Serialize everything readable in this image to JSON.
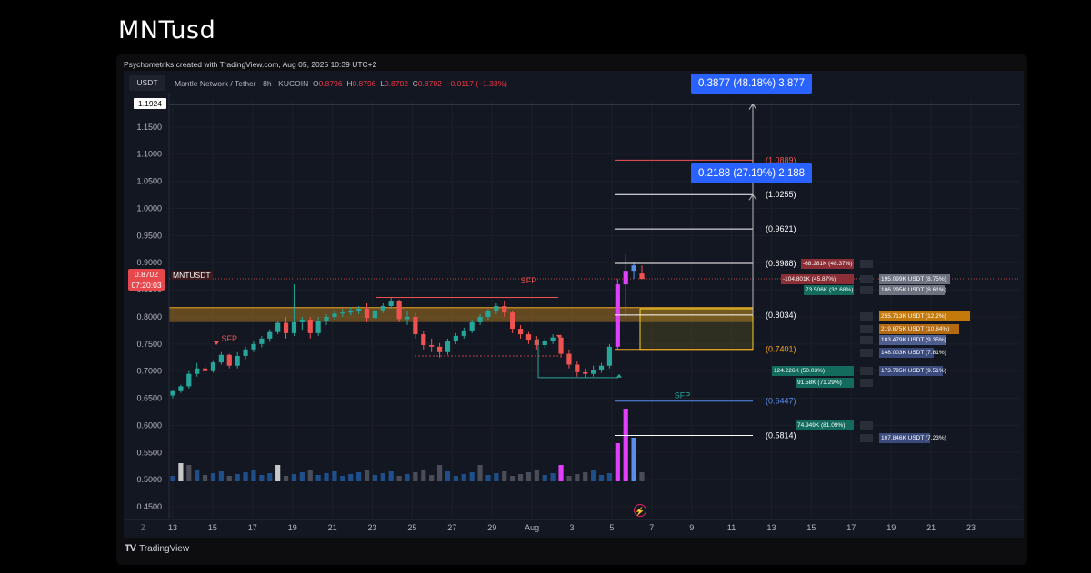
{
  "page": {
    "title": "MNTusd",
    "credit": "Psychometriks created with TradingView.com, Aug 05, 2025 10:39 UTC+2"
  },
  "header": {
    "currency": "USDT",
    "name": "Mantle Network / Tether · 8h · KUCOIN",
    "o_label": "O",
    "o": "0.8796",
    "h_label": "H",
    "h": "0.8796",
    "l_label": "L",
    "l": "0.8702",
    "c_label": "C",
    "c": "0.8702",
    "change": "−0.0117 (−1.33%)"
  },
  "price_tag": {
    "symbol": "MNTUSDT",
    "price": "0.8702",
    "countdown": "07:20:03"
  },
  "top_marker": "1.1924",
  "callouts": {
    "upper": "0.3877 (48.18%) 3,877",
    "lower": "0.2188 (27.19%) 2,188"
  },
  "footer": {
    "brand": "TradingView",
    "zoom": "Z"
  },
  "colors": {
    "up": "#26a69a",
    "down": "#ef5350",
    "zone": "#f5a623",
    "grid": "#1c1f26",
    "accent": "#2962ff"
  },
  "chart_data": {
    "type": "candlestick",
    "ylim": [
      0.43,
      1.2
    ],
    "y_ticks": [
      "1.1500",
      "1.1000",
      "1.0500",
      "1.0000",
      "0.9500",
      "0.9000",
      "0.8500",
      "0.8000",
      "0.7500",
      "0.7000",
      "0.6500",
      "0.6000",
      "0.5500",
      "0.5000",
      "0.4500"
    ],
    "x_ticks": [
      "13",
      "15",
      "17",
      "19",
      "21",
      "23",
      "25",
      "27",
      "29",
      "Aug",
      "3",
      "5",
      "7",
      "9",
      "11",
      "13",
      "15",
      "17",
      "19",
      "21",
      "23"
    ],
    "candles": [
      [
        0.655,
        0.665,
        0.65,
        0.663
      ],
      [
        0.663,
        0.675,
        0.66,
        0.672
      ],
      [
        0.672,
        0.7,
        0.668,
        0.695
      ],
      [
        0.695,
        0.715,
        0.69,
        0.705
      ],
      [
        0.705,
        0.712,
        0.695,
        0.7
      ],
      [
        0.7,
        0.72,
        0.697,
        0.716
      ],
      [
        0.716,
        0.735,
        0.712,
        0.73
      ],
      [
        0.73,
        0.732,
        0.705,
        0.71
      ],
      [
        0.71,
        0.735,
        0.705,
        0.728
      ],
      [
        0.728,
        0.745,
        0.722,
        0.74
      ],
      [
        0.74,
        0.755,
        0.735,
        0.75
      ],
      [
        0.75,
        0.765,
        0.744,
        0.76
      ],
      [
        0.76,
        0.777,
        0.754,
        0.772
      ],
      [
        0.772,
        0.793,
        0.768,
        0.789
      ],
      [
        0.789,
        0.8,
        0.76,
        0.77
      ],
      [
        0.77,
        0.86,
        0.765,
        0.79
      ],
      [
        0.79,
        0.8,
        0.776,
        0.795
      ],
      [
        0.795,
        0.8,
        0.76,
        0.77
      ],
      [
        0.77,
        0.8,
        0.765,
        0.792
      ],
      [
        0.792,
        0.805,
        0.785,
        0.8
      ],
      [
        0.8,
        0.812,
        0.795,
        0.806
      ],
      [
        0.806,
        0.815,
        0.8,
        0.808
      ],
      [
        0.808,
        0.818,
        0.803,
        0.81
      ],
      [
        0.81,
        0.82,
        0.805,
        0.815
      ],
      [
        0.815,
        0.825,
        0.79,
        0.798
      ],
      [
        0.798,
        0.818,
        0.792,
        0.812
      ],
      [
        0.812,
        0.825,
        0.807,
        0.82
      ],
      [
        0.82,
        0.835,
        0.815,
        0.83
      ],
      [
        0.83,
        0.832,
        0.79,
        0.796
      ],
      [
        0.796,
        0.81,
        0.785,
        0.8
      ],
      [
        0.8,
        0.808,
        0.76,
        0.768
      ],
      [
        0.768,
        0.775,
        0.74,
        0.748
      ],
      [
        0.748,
        0.76,
        0.735,
        0.745
      ],
      [
        0.745,
        0.752,
        0.725,
        0.735
      ],
      [
        0.735,
        0.76,
        0.73,
        0.755
      ],
      [
        0.755,
        0.77,
        0.75,
        0.765
      ],
      [
        0.765,
        0.78,
        0.76,
        0.775
      ],
      [
        0.775,
        0.795,
        0.77,
        0.79
      ],
      [
        0.79,
        0.805,
        0.785,
        0.8
      ],
      [
        0.8,
        0.815,
        0.795,
        0.81
      ],
      [
        0.81,
        0.825,
        0.805,
        0.82
      ],
      [
        0.82,
        0.83,
        0.8,
        0.808
      ],
      [
        0.808,
        0.81,
        0.77,
        0.778
      ],
      [
        0.778,
        0.785,
        0.76,
        0.768
      ],
      [
        0.768,
        0.772,
        0.75,
        0.758
      ],
      [
        0.758,
        0.765,
        0.74,
        0.748
      ],
      [
        0.748,
        0.76,
        0.742,
        0.755
      ],
      [
        0.755,
        0.768,
        0.75,
        0.762
      ],
      [
        0.762,
        0.765,
        0.725,
        0.732
      ],
      [
        0.732,
        0.74,
        0.705,
        0.712
      ],
      [
        0.712,
        0.718,
        0.69,
        0.698
      ],
      [
        0.698,
        0.705,
        0.688,
        0.695
      ],
      [
        0.695,
        0.71,
        0.69,
        0.702
      ],
      [
        0.702,
        0.715,
        0.697,
        0.71
      ],
      [
        0.71,
        0.75,
        0.705,
        0.745
      ],
      [
        0.745,
        0.87,
        0.74,
        0.86
      ],
      [
        0.86,
        0.915,
        0.8,
        0.885
      ],
      [
        0.885,
        0.9,
        0.87,
        0.895
      ],
      [
        0.88,
        0.895,
        0.87,
        0.87
      ]
    ],
    "levels": [
      {
        "label": "(1.0889)",
        "value": 1.0889,
        "color": "#ef5350"
      },
      {
        "label": "(1.0255)",
        "value": 1.0255,
        "color": "#ffffff"
      },
      {
        "label": "(0.9621)",
        "value": 0.9621,
        "color": "#ffffff"
      },
      {
        "label": "(0.8988)",
        "value": 0.8988,
        "color": "#ffffff"
      },
      {
        "label": "(0.8034)",
        "value": 0.8034,
        "color": "#ffffff"
      },
      {
        "label": "(0.7401)",
        "value": 0.7401,
        "color": "#f5a623"
      },
      {
        "label": "(0.6447)",
        "value": 0.6447,
        "color": "#5b8def"
      },
      {
        "label": "(0.5814)",
        "value": 0.5814,
        "color": "#ffffff"
      }
    ],
    "annotations": [
      {
        "text": "SFP",
        "color": "#ef5350",
        "x_index": 7,
        "y": 0.755
      },
      {
        "text": "SFP",
        "color": "#ef5350",
        "x_index": 44,
        "y": 0.862
      },
      {
        "text": "SFP",
        "color": "#26a69a",
        "x_index": 63,
        "y": 0.65
      }
    ],
    "volume_profile": [
      {
        "label": "-68.281K (48.37%)",
        "price": 0.8988,
        "color": "#8b2e36",
        "width": 58
      },
      {
        "label": "-104.801K (45.87%)",
        "price": 0.871,
        "color": "#8b2e36",
        "width": 80
      },
      {
        "label": "195.099K USDT (8.75%)",
        "price": 0.871,
        "color": "#6d7280",
        "width": 78,
        "side": "right"
      },
      {
        "label": "73.506K (32.68%)",
        "price": 0.85,
        "color": "#136b5e",
        "width": 55
      },
      {
        "label": "186.295K USDT (8.61%)",
        "price": 0.85,
        "color": "#6d7280",
        "width": 72,
        "side": "right"
      },
      {
        "label": "255.713K USDT (12.2%)",
        "price": 0.801,
        "color": "#c47a0a",
        "width": 100,
        "side": "right"
      },
      {
        "label": "219.875K USDT (10.84%)",
        "price": 0.778,
        "color": "#b36a10",
        "width": 88,
        "side": "right"
      },
      {
        "label": "183.479K USDT (9.35%)",
        "price": 0.758,
        "color": "#4d5e8f",
        "width": 74,
        "side": "right"
      },
      {
        "label": "148.003K USDT (7.81%)",
        "price": 0.735,
        "color": "#3a4a7c",
        "width": 60,
        "side": "right"
      },
      {
        "label": "124.226K (50.03%)",
        "price": 0.701,
        "color": "#136b5e",
        "width": 90
      },
      {
        "label": "173.795K USDT (9.51%)",
        "price": 0.701,
        "color": "#3a4a7c",
        "width": 70,
        "side": "right"
      },
      {
        "label": "91.58K (71.29%)",
        "price": 0.679,
        "color": "#136b5e",
        "width": 64
      },
      {
        "label": "74.949K (81.09%)",
        "price": 0.6,
        "color": "#136b5e",
        "width": 64
      },
      {
        "label": "107.846K USDT (7.23%)",
        "price": 0.578,
        "color": "#3a4a7c",
        "width": 56,
        "side": "right"
      }
    ]
  }
}
